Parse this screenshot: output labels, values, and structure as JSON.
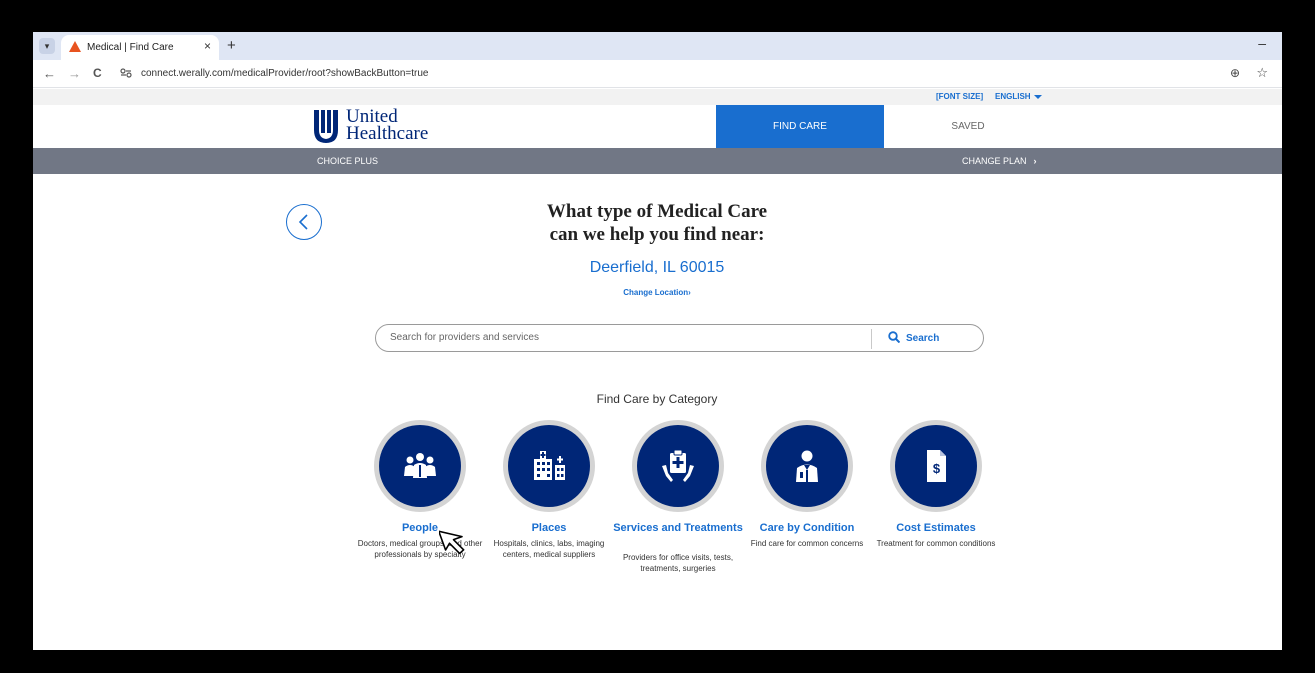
{
  "browser": {
    "tab_title": "Medical | Find Care",
    "tab_close": "×",
    "new_tab": "+",
    "minimize": "–",
    "back": "←",
    "forward": "→",
    "reload": "C",
    "url": "connect.werally.com/medicalProvider/root?showBackButton=true",
    "zoom_icon": "⊕",
    "bookmark_icon": "☆"
  },
  "utility": {
    "font_size": "[FONT SIZE]",
    "language": "ENGLISH"
  },
  "brand": {
    "line1": "United",
    "line2": "Healthcare",
    "color": "#002677"
  },
  "nav": {
    "find_care": "FIND CARE",
    "saved": "SAVED",
    "accent": "#196ecf"
  },
  "plan": {
    "name": "CHOICE PLUS",
    "change": "CHANGE PLAN"
  },
  "main": {
    "headline_line1": "What type of Medical Care",
    "headline_line2": "can we help you find near:",
    "location": "Deerfield, IL 60015",
    "change_location": "Change Location"
  },
  "search": {
    "placeholder": "Search for providers and services",
    "button": "Search"
  },
  "categories": {
    "heading": "Find Care by Category",
    "items": [
      {
        "label": "People",
        "desc": "Doctors, medical groups, and other professionals by specialty",
        "icon": "people-icon"
      },
      {
        "label": "Places",
        "desc": "Hospitals, clinics, labs, imaging centers, medical suppliers",
        "icon": "hospital-icon"
      },
      {
        "label": "Services and Treatments",
        "desc": "Providers for office visits, tests, treatments, surgeries",
        "icon": "clipboard-hands-icon"
      },
      {
        "label": "Care by Condition",
        "desc": "Find care for common concerns",
        "icon": "doctor-icon"
      },
      {
        "label": "Cost Estimates",
        "desc": "Treatment for common conditions",
        "icon": "dollar-document-icon"
      }
    ]
  }
}
